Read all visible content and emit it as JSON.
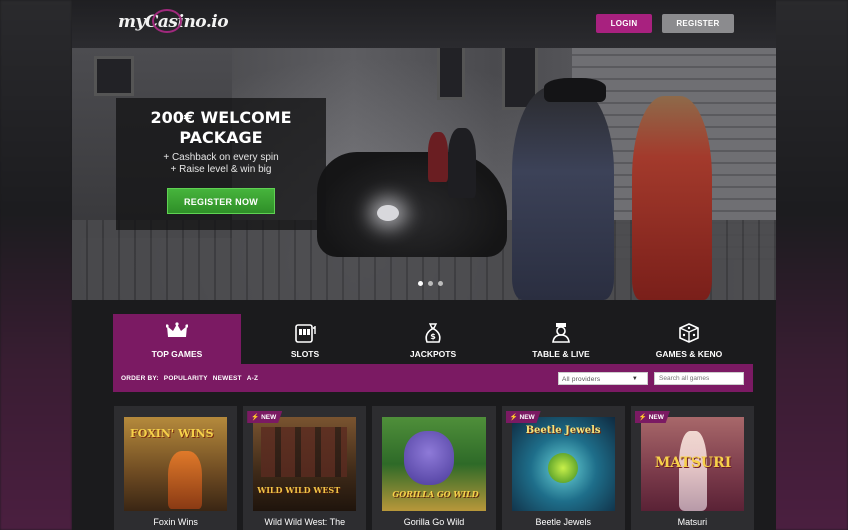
{
  "header": {
    "logo_text": "myCasino.io",
    "login_label": "LOGIN",
    "register_label": "REGISTER"
  },
  "hero": {
    "title_line1": "200€ WELCOME",
    "title_line2": "PACKAGE",
    "bullet1": "+ Cashback on every spin",
    "bullet2": "+ Raise level & win big",
    "cta_label": "REGISTER NOW"
  },
  "nav": {
    "tabs": [
      {
        "label": "TOP GAMES",
        "icon": "crown-icon"
      },
      {
        "label": "SLOTS",
        "icon": "slot-machine-icon"
      },
      {
        "label": "JACKPOTS",
        "icon": "money-bag-icon"
      },
      {
        "label": "TABLE & LIVE",
        "icon": "dealer-icon"
      },
      {
        "label": "GAMES & KENO",
        "icon": "dice-icon"
      }
    ]
  },
  "filter": {
    "order_by_label": "ORDER BY:",
    "options": [
      "POPULARITY",
      "NEWEST",
      "A-Z"
    ],
    "provider_value": "All providers",
    "search_placeholder": "Search all games"
  },
  "games": [
    {
      "title": "Foxin Wins",
      "badge": "",
      "art_text": "FOXIN' WINS"
    },
    {
      "title": "Wild Wild West: The",
      "badge": "NEW",
      "art_text": "WILD WILD WEST"
    },
    {
      "title": "Gorilla Go Wild",
      "badge": "",
      "art_text": "GORILLA GO WILD"
    },
    {
      "title": "Beetle Jewels",
      "badge": "NEW",
      "art_text": "Beetle Jewels"
    },
    {
      "title": "Matsuri",
      "badge": "NEW",
      "art_text": "MATSURI"
    }
  ],
  "colors": {
    "accent": "#7b1a63",
    "login": "#a8217f",
    "cta_green": "#3aa532"
  }
}
